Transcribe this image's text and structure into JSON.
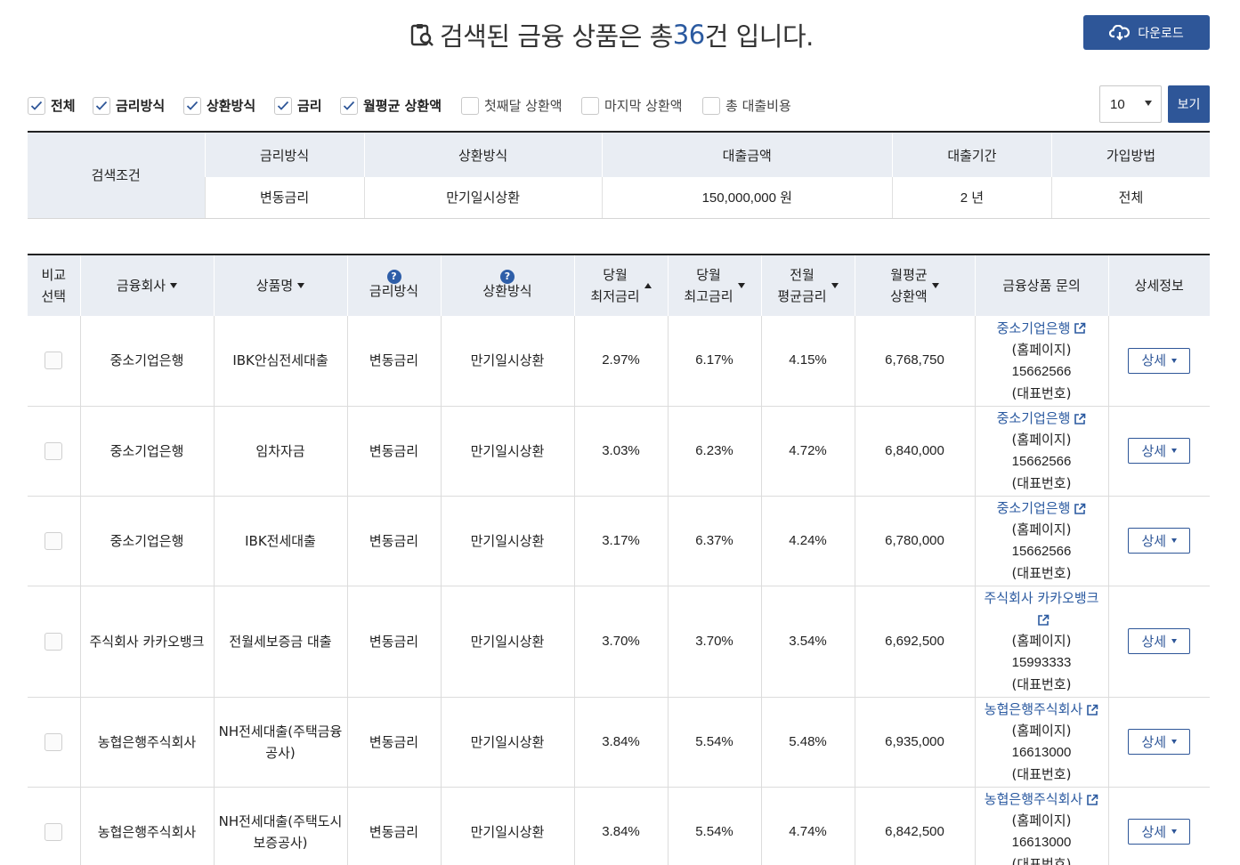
{
  "header": {
    "title_prefix": "검색된 금융 상품은 총 ",
    "title_count": "36",
    "title_suffix": "건 입니다.",
    "download_label": "다운로드"
  },
  "filters": {
    "checkboxes": [
      {
        "label": "전체",
        "checked": true
      },
      {
        "label": "금리방식",
        "checked": true
      },
      {
        "label": "상환방식",
        "checked": true
      },
      {
        "label": "금리",
        "checked": true
      },
      {
        "label": "월평균 상환액",
        "checked": true
      },
      {
        "label": "첫째달 상환액",
        "checked": false
      },
      {
        "label": "마지막 상환액",
        "checked": false
      },
      {
        "label": "총 대출비용",
        "checked": false
      }
    ],
    "page_size": "10",
    "view_label": "보기"
  },
  "conditions": {
    "label": "검색조건",
    "headers": [
      "금리방식",
      "상환방식",
      "대출금액",
      "대출기간",
      "가입방법"
    ],
    "values": [
      "변동금리",
      "만기일시상환",
      "150,000,000 원",
      "2 년",
      "전체"
    ]
  },
  "results": {
    "headers": {
      "compare_1": "비교",
      "compare_2": "선택",
      "company": "금융회사",
      "product": "상품명",
      "rate_type": "금리방식",
      "repay_type": "상환방식",
      "min_rate_1": "당월",
      "min_rate_2": "최저금리",
      "max_rate_1": "당월",
      "max_rate_2": "최고금리",
      "avg_rate_1": "전월",
      "avg_rate_2": "평균금리",
      "monthly_1": "월평균",
      "monthly_2": "상환액",
      "inquiry": "금융상품 문의",
      "detail": "상세정보"
    },
    "help_glyph": "?",
    "homepage_label": "(홈페이지)",
    "rep_label": "(대표번호)",
    "detail_button": "상세",
    "rows": [
      {
        "company": "중소기업은행",
        "product_1": "IBK안심전세대출",
        "product_2": "",
        "rate_type": "변동금리",
        "repay": "만기일시상환",
        "min": "2.97%",
        "max": "6.17%",
        "avg": "4.15%",
        "monthly": "6,768,750",
        "inq_1": "중소기업은행",
        "inq_2": "",
        "phone": "15662566"
      },
      {
        "company": "중소기업은행",
        "product_1": "임차자금",
        "product_2": "",
        "rate_type": "변동금리",
        "repay": "만기일시상환",
        "min": "3.03%",
        "max": "6.23%",
        "avg": "4.72%",
        "monthly": "6,840,000",
        "inq_1": "중소기업은행",
        "inq_2": "",
        "phone": "15662566"
      },
      {
        "company": "중소기업은행",
        "product_1": "IBK전세대출",
        "product_2": "",
        "rate_type": "변동금리",
        "repay": "만기일시상환",
        "min": "3.17%",
        "max": "6.37%",
        "avg": "4.24%",
        "monthly": "6,780,000",
        "inq_1": "중소기업은행",
        "inq_2": "",
        "phone": "15662566"
      },
      {
        "company": "주식회사 카카오뱅크",
        "product_1": "전월세보증금 대출",
        "product_2": "",
        "rate_type": "변동금리",
        "repay": "만기일시상환",
        "min": "3.70%",
        "max": "3.70%",
        "avg": "3.54%",
        "monthly": "6,692,500",
        "inq_1": "주식회사 카카오뱅크",
        "inq_2": "",
        "phone": "15993333"
      },
      {
        "company": "농협은행주식회사",
        "product_1": "NH전세대출(주택금융",
        "product_2": "공사)",
        "rate_type": "변동금리",
        "repay": "만기일시상환",
        "min": "3.84%",
        "max": "5.54%",
        "avg": "5.48%",
        "monthly": "6,935,000",
        "inq_1": "농협은행주식회사",
        "inq_2": "",
        "phone": "16613000"
      },
      {
        "company": "농협은행주식회사",
        "product_1": "NH전세대출(주택도시",
        "product_2": "보증공사)",
        "rate_type": "변동금리",
        "repay": "만기일시상환",
        "min": "3.84%",
        "max": "5.54%",
        "avg": "4.74%",
        "monthly": "6,842,500",
        "inq_1": "농협은행주식회사",
        "inq_2": "",
        "phone": "16613000"
      }
    ]
  }
}
